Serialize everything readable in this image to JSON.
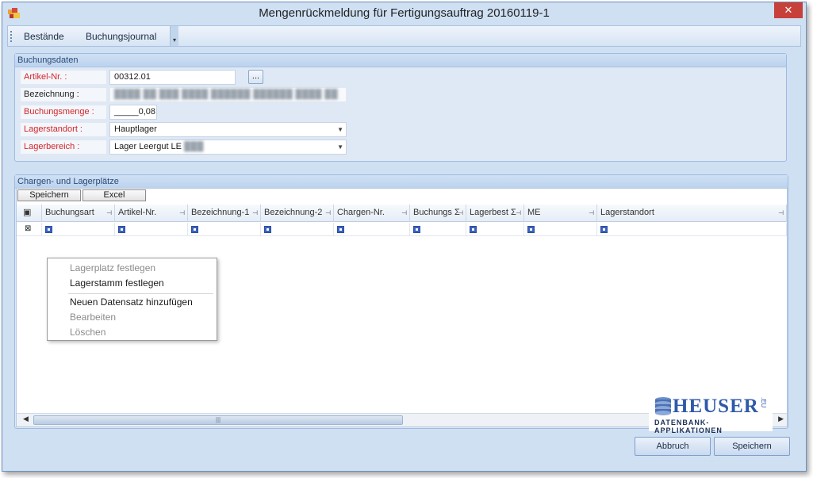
{
  "window": {
    "title": "Mengenrückmeldung für Fertigungsauftrag 20160119-1",
    "close_glyph": "✕"
  },
  "menu": {
    "items": [
      "Bestände",
      "Buchungsjournal"
    ],
    "overflow_glyph": "▾"
  },
  "buchungsdaten": {
    "header": "Buchungsdaten",
    "artikel": {
      "label": "Artikel-Nr. :",
      "value": "00312.01",
      "button": "..."
    },
    "bezeichnung": {
      "label": "Bezeichnung :",
      "value": "████ ██ ███ ████ ██████ ██████ ████ ██"
    },
    "menge": {
      "label": "Buchungsmenge :",
      "value": "_____0,08"
    },
    "lagerstandort": {
      "label": "Lagerstandort :",
      "value": "Hauptlager"
    },
    "lagerbereich": {
      "label": "Lagerbereich :",
      "value": "Lager Leergut LE",
      "value_blur": "███"
    }
  },
  "chargen": {
    "header": "Chargen- und Lagerplätze",
    "toolbar": {
      "save": "Speichern",
      "excel": "Excel"
    },
    "columns": [
      "Buchungsart",
      "Artikel-Nr.",
      "Bezeichnung-1",
      "Bezeichnung-2",
      "Chargen-Nr.",
      "Buchungs Σ",
      "Lagerbest Σ",
      "ME",
      "Lagerstandort"
    ]
  },
  "context_menu": {
    "items": [
      {
        "label": "Lagerplatz festlegen",
        "enabled": false
      },
      {
        "label": "Lagerstamm festlegen",
        "enabled": true
      },
      {
        "label": "Neuen Datensatz hinzufügen",
        "enabled": true
      },
      {
        "label": "Bearbeiten",
        "enabled": false
      },
      {
        "label": "Löschen",
        "enabled": false
      }
    ]
  },
  "logo": {
    "name": "HEUSER",
    "tld": ".EU",
    "tagline": "DATENBANK-APPLIKATIONEN"
  },
  "buttons": {
    "cancel": "Abbruch",
    "save": "Speichern"
  },
  "colors": {
    "required_label": "#d3262b",
    "accent": "#2e5aa8",
    "close": "#c7413a"
  }
}
